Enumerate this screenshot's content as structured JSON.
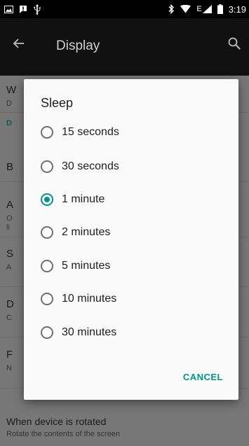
{
  "status_bar": {
    "time": "3:19",
    "network_label": "E",
    "icons": [
      "image-icon",
      "alert-icon",
      "usb-icon",
      "bluetooth-icon",
      "wifi-icon",
      "signal-icon",
      "battery-icon"
    ]
  },
  "app_bar": {
    "title": "Display",
    "back_icon": "back-arrow-icon",
    "search_icon": "search-icon"
  },
  "background_prefs": [
    {
      "title": "W",
      "summary": "D"
    },
    {
      "section": "D"
    },
    {
      "title": "B"
    },
    {
      "title": "A",
      "summary": "O",
      "summary2": "li"
    },
    {
      "title": "S",
      "summary": "A"
    },
    {
      "title": "D",
      "summary": "C"
    },
    {
      "title": "F",
      "summary": "N"
    },
    {
      "title": "When device is rotated",
      "summary": "Rotate the contents of the screen"
    }
  ],
  "dialog": {
    "title": "Sleep",
    "options": [
      {
        "label": "15 seconds",
        "selected": false
      },
      {
        "label": "30 seconds",
        "selected": false
      },
      {
        "label": "1 minute",
        "selected": true
      },
      {
        "label": "2 minutes",
        "selected": false
      },
      {
        "label": "5 minutes",
        "selected": false
      },
      {
        "label": "10 minutes",
        "selected": false
      },
      {
        "label": "30 minutes",
        "selected": false
      }
    ],
    "cancel_label": "CANCEL"
  },
  "colors": {
    "accent": "#009688",
    "status_bar": "#000000",
    "app_bar": "#111111",
    "scrim": "#777777",
    "dialog_bg": "#fafafa"
  }
}
